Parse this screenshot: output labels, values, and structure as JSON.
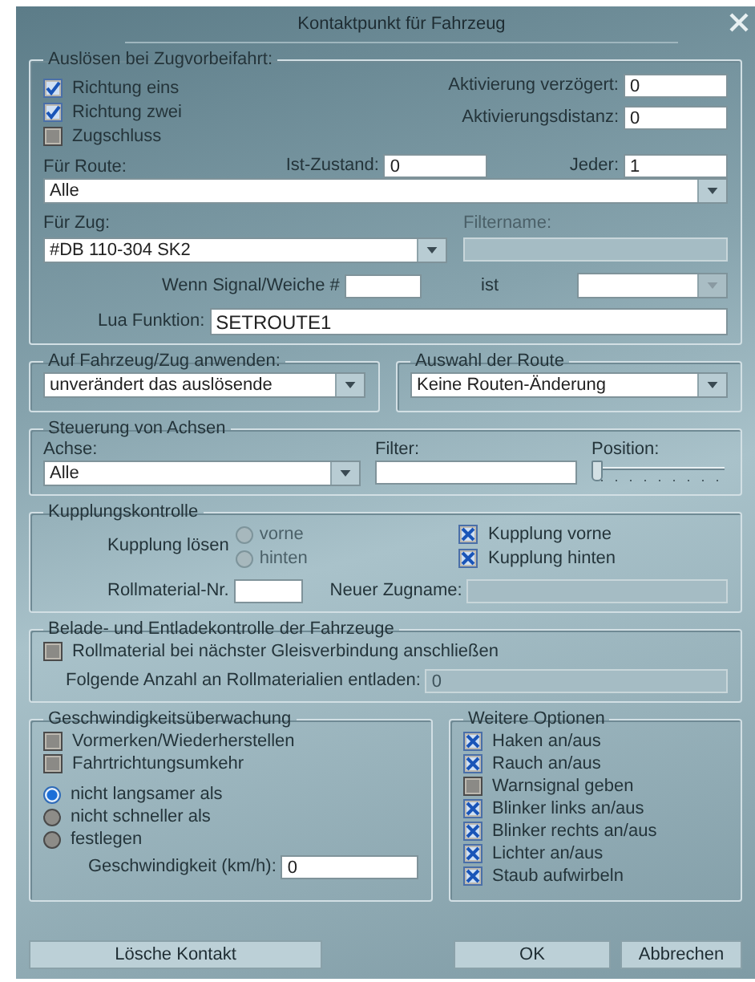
{
  "window": {
    "title": "Kontaktpunkt für Fahrzeug"
  },
  "trigger": {
    "legend": "Auslösen bei Zugvorbeifahrt:",
    "checkboxes": [
      {
        "label": "Richtung eins",
        "checked": true
      },
      {
        "label": "Richtung zwei",
        "checked": true
      },
      {
        "label": "Zugschluss",
        "checked": false
      }
    ],
    "delay": {
      "label": "Aktivierung verzögert:",
      "value": "0"
    },
    "distance": {
      "label": "Aktivierungsdistanz:",
      "value": "0"
    },
    "state": {
      "label": "Ist-Zustand:",
      "value": "0"
    },
    "every": {
      "label": "Jeder:",
      "value": "1"
    },
    "route": {
      "label": "Für Route:",
      "value": "Alle"
    },
    "train": {
      "label": "Für Zug:",
      "value": "#DB 110-304 SK2"
    },
    "filter_name": {
      "label": "Filtername:",
      "disabled": true
    },
    "signal": {
      "label": "Wenn Signal/Weiche #"
    },
    "is": {
      "label": "ist"
    },
    "lua": {
      "label": "Lua Funktion:",
      "value": "SETROUTE1"
    }
  },
  "apply": {
    "legend": "Auf Fahrzeug/Zug anwenden:",
    "value": "unverändert das auslösende"
  },
  "route_choice": {
    "legend": "Auswahl der Route",
    "value": "Keine Routen-Änderung"
  },
  "axes": {
    "legend": "Steuerung von Achsen",
    "axis": {
      "label": "Achse:",
      "value": "Alle"
    },
    "filter": {
      "label": "Filter:"
    },
    "position": {
      "label": "Position:",
      "level": 0
    }
  },
  "coupling": {
    "legend": "Kupplungskontrolle",
    "release_label": "Kupplung lösen",
    "radios": [
      {
        "label": "vorne",
        "selected": false,
        "disabled": true
      },
      {
        "label": "hinten",
        "selected": false,
        "disabled": true
      }
    ],
    "checkboxes": [
      {
        "label": "Kupplung vorne",
        "checked": true
      },
      {
        "label": "Kupplung hinten",
        "checked": true
      }
    ],
    "stock_no": {
      "label": "Rollmaterial-Nr."
    },
    "new_name": {
      "label": "Neuer Zugname:",
      "disabled": true
    }
  },
  "loading": {
    "legend": "Belade- und Entladekontrolle der Fahrzeuge",
    "checkbox": {
      "label": "Rollmaterial bei nächster Gleisverbindung anschließen",
      "checked": false
    },
    "unload": {
      "label": "Folgende Anzahl an Rollmaterialien entladen:",
      "value": "0",
      "disabled": true
    }
  },
  "speed": {
    "legend": "Geschwindigkeitsüberwachung",
    "checkboxes": [
      {
        "label": "Vormerken/Wiederherstellen",
        "checked": false
      },
      {
        "label": "Fahrtrichtungsumkehr",
        "checked": false
      }
    ],
    "radios": [
      {
        "label": "nicht langsamer als",
        "selected": true
      },
      {
        "label": "nicht schneller als",
        "selected": false
      },
      {
        "label": "festlegen",
        "selected": false
      }
    ],
    "speed": {
      "label": "Geschwindigkeit (km/h):",
      "value": "0"
    }
  },
  "options": {
    "legend": "Weitere Optionen",
    "checkboxes": [
      {
        "label": "Haken an/aus",
        "checked": true
      },
      {
        "label": "Rauch an/aus",
        "checked": true
      },
      {
        "label": "Warnsignal geben",
        "checked": false
      },
      {
        "label": "Blinker links an/aus",
        "checked": true
      },
      {
        "label": "Blinker rechts an/aus",
        "checked": true
      },
      {
        "label": "Lichter an/aus",
        "checked": true
      },
      {
        "label": "Staub aufwirbeln",
        "checked": true
      }
    ]
  },
  "buttons": [
    {
      "label": "Lösche Kontakt"
    },
    {
      "label": "OK"
    },
    {
      "label": "Abbrechen"
    }
  ]
}
